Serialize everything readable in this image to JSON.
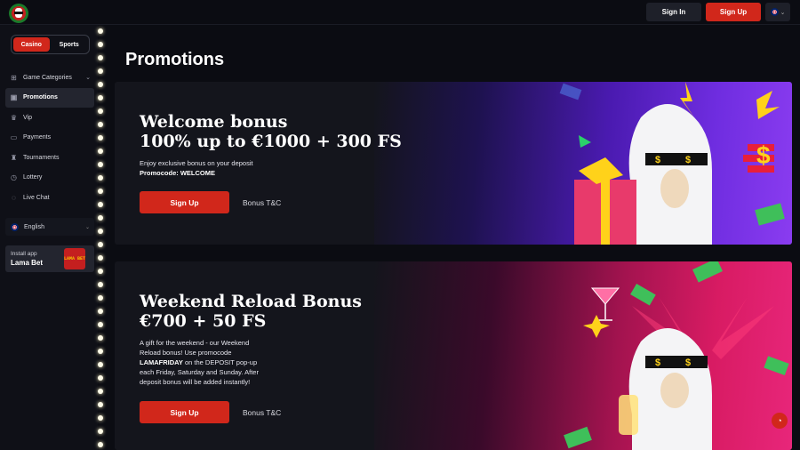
{
  "header": {
    "sign_in": "Sign In",
    "sign_up": "Sign Up"
  },
  "sidebar": {
    "toggle": {
      "casino": "Casino",
      "sports": "Sports"
    },
    "items": [
      {
        "label": "Game Categories",
        "icon": "grid-icon",
        "active": false
      },
      {
        "label": "Promotions",
        "icon": "gift-icon",
        "active": true
      },
      {
        "label": "Vip",
        "icon": "crown-icon",
        "active": false
      },
      {
        "label": "Payments",
        "icon": "wallet-icon",
        "active": false
      },
      {
        "label": "Tournaments",
        "icon": "trophy-icon",
        "active": false
      },
      {
        "label": "Lottery",
        "icon": "ticket-icon",
        "active": false
      },
      {
        "label": "Live Chat",
        "icon": "chat-icon",
        "active": false
      }
    ],
    "language": "English",
    "install": {
      "line1": "Install app",
      "line2": "Lama Bet",
      "app_icon_text": "LAMA BET"
    }
  },
  "main": {
    "title": "Promotions",
    "promos": [
      {
        "title_line1": "Welcome bonus",
        "title_line2": "100% up to €1000 + 300 FS",
        "desc_line1": "Enjoy exclusive bonus on your deposit",
        "desc_line2": "Promocode: WELCOME",
        "cta": "Sign Up",
        "terms": "Bonus T&C"
      },
      {
        "title_line1": "Weekend Reload Bonus",
        "title_line2": "€700 + 50 FS",
        "desc_line1": "A gift for the weekend - our Weekend",
        "desc_line2": "Reload bonus! Use promocode",
        "desc_line3_bold": "LAMAFRIDAY",
        "desc_line3_rest": " on the DEPOSIT pop-up",
        "desc_line4": "each Friday, Saturday and Sunday. After",
        "desc_line5": "deposit bonus will be added instantly!",
        "cta": "Sign Up",
        "terms": "Bonus T&C"
      }
    ]
  },
  "colors": {
    "accent": "#d1271b",
    "bg": "#0b0c12",
    "sidebar": "#0f1017",
    "card": "#14151c"
  }
}
